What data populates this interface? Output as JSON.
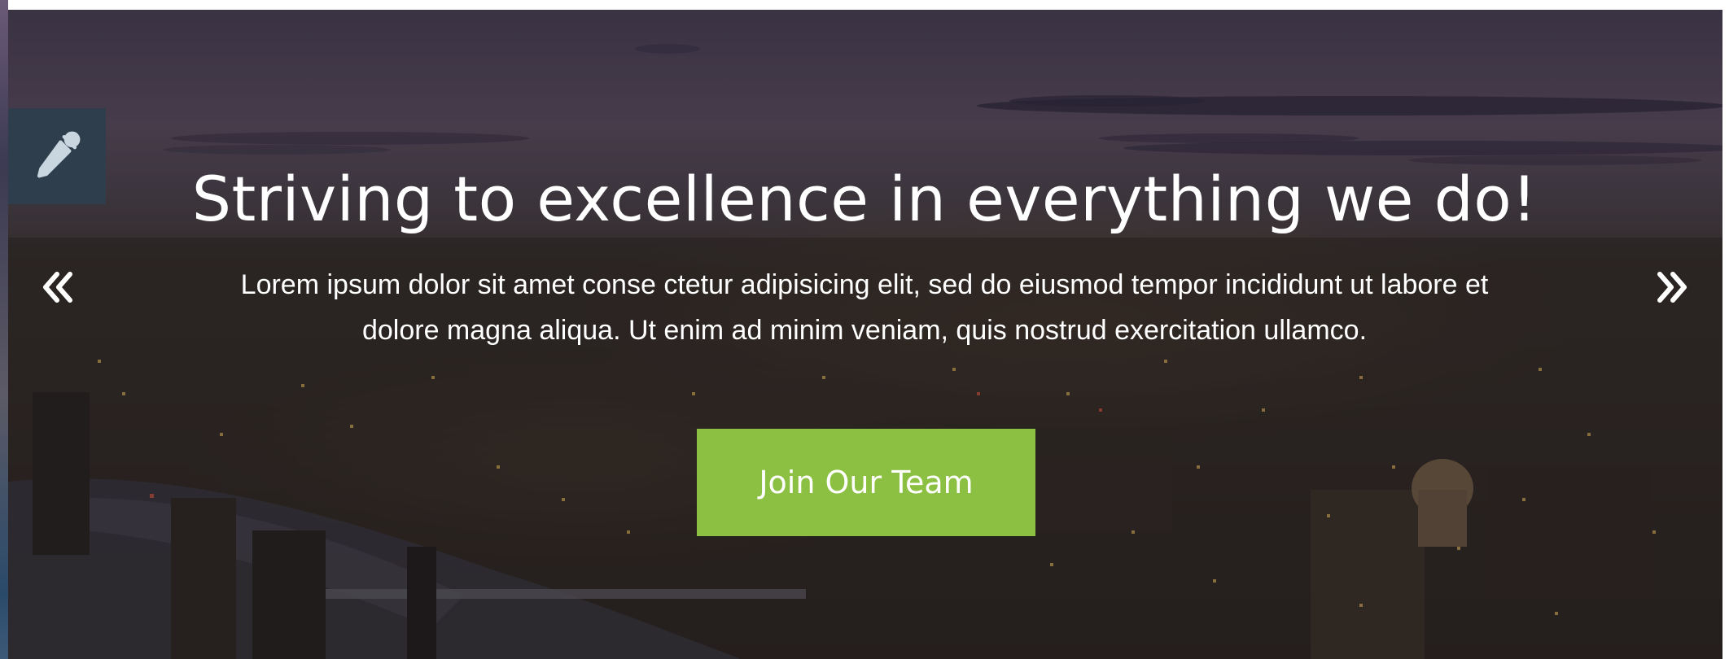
{
  "hero": {
    "title": "Striving to excellence in everything we do!",
    "text": "Lorem ipsum dolor sit amet conse ctetur adipisicing elit, sed do eiusmod tempor incididunt ut labore et dolore magna aliqua. Ut enim ad minim veniam, quis nostrud exercitation ullamco.",
    "cta_label": "Join Our Team"
  },
  "controls": {
    "prev_icon": "double-chevron-left-icon",
    "next_icon": "double-chevron-right-icon",
    "picker_icon": "eyedropper-icon"
  },
  "colors": {
    "cta": "#8cc042",
    "picker_bg": "#2f3e4c",
    "text": "#ffffff"
  }
}
